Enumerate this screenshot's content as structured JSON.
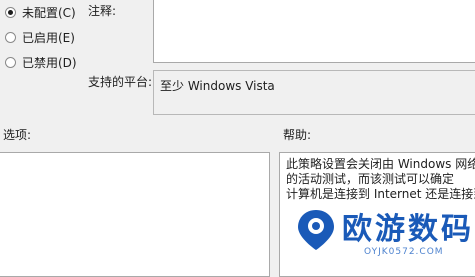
{
  "state_options": [
    {
      "label": "未配置(C)",
      "checked": true
    },
    {
      "label": "已启用(E)",
      "checked": false
    },
    {
      "label": "已禁用(D)",
      "checked": false
    }
  ],
  "comment": {
    "label": "注释:",
    "value": ""
  },
  "supported": {
    "label": "支持的平台:",
    "value": "至少 Windows Vista"
  },
  "options": {
    "label": "选项:"
  },
  "help": {
    "label": "帮助:",
    "lines": [
      "此策略设置会关闭由 Windows 网络连接",
      "的活动测试，而该测试可以确定",
      "计算机是连接到 Internet 还是连接到受"
    ]
  },
  "watermark": {
    "title": "欧游数码",
    "subtitle": "OYJK0572.COM"
  },
  "colors": {
    "background": "#f0f0f0",
    "watermark": "#1a5ab8"
  }
}
